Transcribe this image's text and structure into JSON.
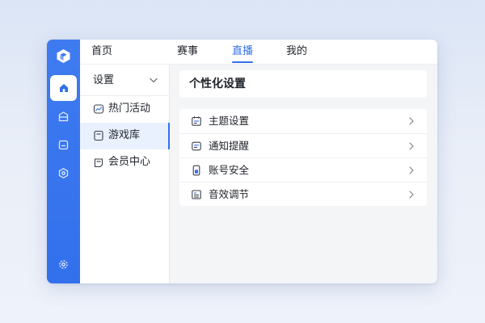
{
  "rail": {
    "icons": [
      "app-logo-icon",
      "home-icon",
      "inbox-icon",
      "calendar-icon",
      "hexagon-icon",
      "settings-gear-icon"
    ],
    "accent": "#3270ec"
  },
  "topnav": {
    "items": [
      {
        "label": "首页",
        "active": false
      },
      {
        "label": "赛事",
        "active": false
      },
      {
        "label": "直播",
        "active": true
      },
      {
        "label": "我的",
        "active": false
      }
    ],
    "bell_icon": "bell-icon"
  },
  "subnav": {
    "title": "设置",
    "items": [
      {
        "label": "热门活动",
        "icon": "activity-icon",
        "active": false
      },
      {
        "label": "游戏库",
        "icon": "game-library-icon",
        "active": true
      },
      {
        "label": "会员中心",
        "icon": "membership-icon",
        "active": false
      }
    ]
  },
  "content": {
    "title": "个性化设置",
    "settings": [
      {
        "label": "主题设置",
        "icon": "calendar-theme-icon"
      },
      {
        "label": "通知提醒",
        "icon": "message-icon"
      },
      {
        "label": "账号安全",
        "icon": "phone-security-icon"
      },
      {
        "label": "音效调节",
        "icon": "list-sound-icon"
      }
    ]
  }
}
